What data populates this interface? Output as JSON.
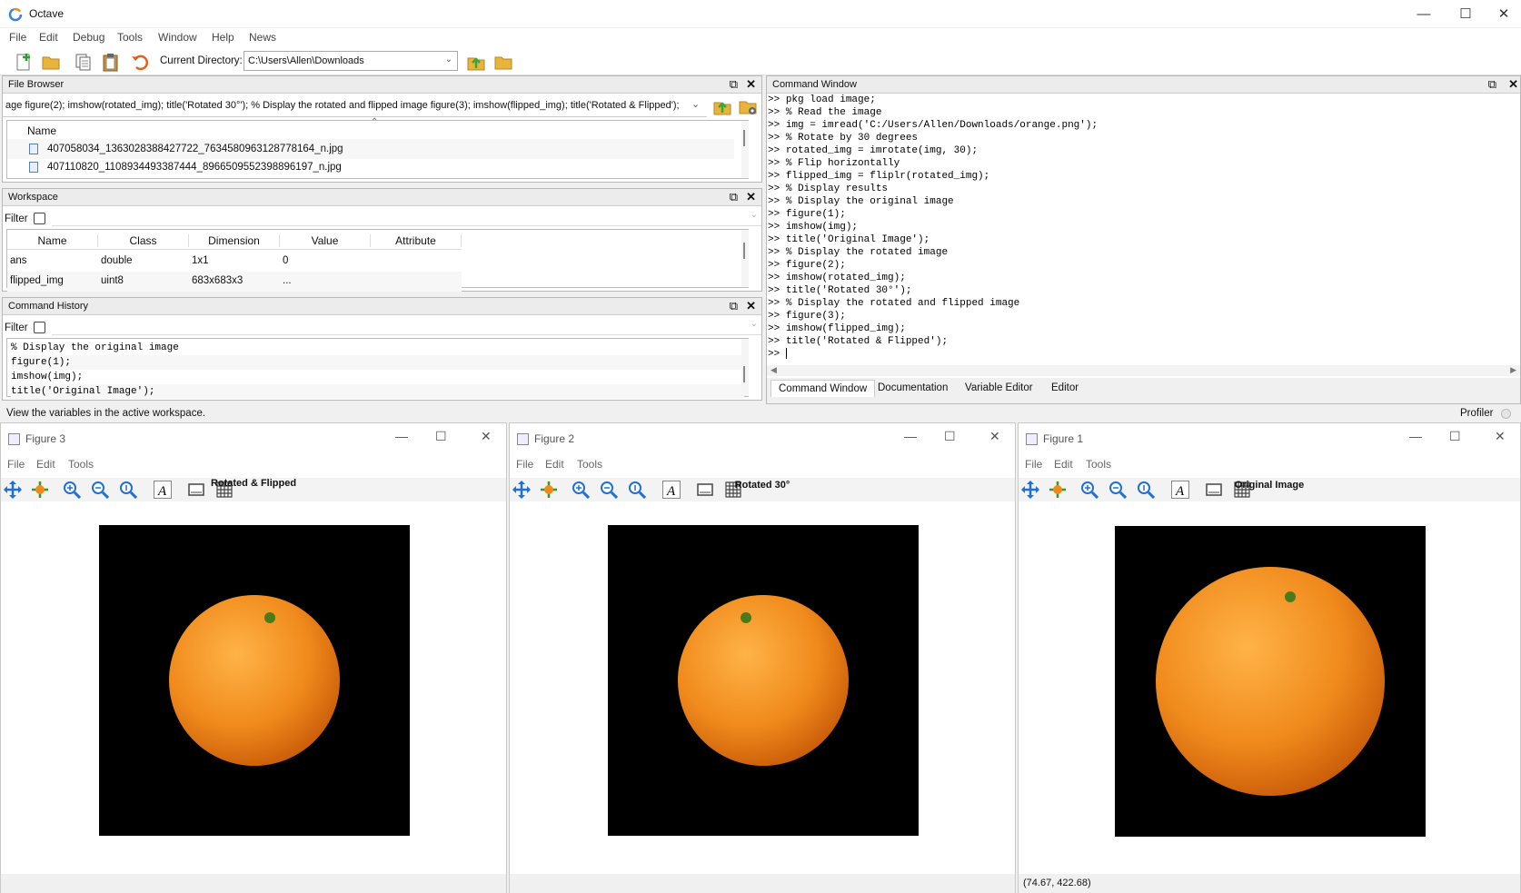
{
  "app": {
    "title": "Octave"
  },
  "menu": [
    "File",
    "Edit",
    "Debug",
    "Tools",
    "Window",
    "Help",
    "News"
  ],
  "toolbar": {
    "current_dir_label": "Current Directory:",
    "current_dir_value": "C:\\Users\\Allen\\Downloads"
  },
  "file_browser": {
    "title": "File Browser",
    "path_value": "age figure(2); imshow(rotated_img); title('Rotated 30°');  % Display the rotated and flipped image figure(3); imshow(flipped_img); title('Rotated & Flipped');",
    "column": "Name",
    "files": [
      "407058034_1363028388427722_7634580963128778164_n.jpg",
      "407110820_1108934493387444_8966509552398896197_n.jpg"
    ]
  },
  "workspace": {
    "title": "Workspace",
    "filter_label": "Filter",
    "columns": [
      "Name",
      "Class",
      "Dimension",
      "Value",
      "Attribute"
    ],
    "rows": [
      {
        "name": "ans",
        "class": "double",
        "dimension": "1x1",
        "value": "0",
        "attribute": ""
      },
      {
        "name": "flipped_img",
        "class": "uint8",
        "dimension": "683x683x3",
        "value": "...",
        "attribute": ""
      }
    ]
  },
  "history": {
    "title": "Command History",
    "filter_label": "Filter",
    "lines": [
      "% Display the original image",
      "figure(1);",
      "imshow(img);",
      "title('Original Image');"
    ]
  },
  "command_window": {
    "title": "Command Window",
    "prompt": ">>",
    "lines": [
      "pkg load image;",
      "% Read the image",
      "img = imread('C:/Users/Allen/Downloads/orange.png');",
      "% Rotate by 30 degrees",
      "rotated_img = imrotate(img, 30);",
      "% Flip horizontally",
      "flipped_img = fliplr(rotated_img);",
      "% Display results",
      "% Display the original image",
      "figure(1);",
      "imshow(img);",
      "title('Original Image');",
      "% Display the rotated image",
      "figure(2);",
      "imshow(rotated_img);",
      "title('Rotated 30°');",
      "% Display the rotated and flipped image",
      "figure(3);",
      "imshow(flipped_img);",
      "title('Rotated & Flipped');",
      ""
    ],
    "tabs": [
      "Command Window",
      "Documentation",
      "Variable Editor",
      "Editor"
    ]
  },
  "status": {
    "text": "View the variables in the active workspace.",
    "profiler": "Profiler"
  },
  "figures": [
    {
      "window_title": "Figure 3",
      "plot_title": "Rotated & Flipped",
      "menu": [
        "File",
        "Edit",
        "Tools"
      ],
      "status": ""
    },
    {
      "window_title": "Figure 2",
      "plot_title": "Rotated 30°",
      "menu": [
        "File",
        "Edit",
        "Tools"
      ],
      "status": ""
    },
    {
      "window_title": "Figure 1",
      "plot_title": "Original Image",
      "menu": [
        "File",
        "Edit",
        "Tools"
      ],
      "status": "(74.67, 422.68)"
    }
  ],
  "colors": {
    "accent_orange": "#f08a1c",
    "icon_blue": "#1e6fd9",
    "folder_yellow": "#e9b43a",
    "green_arrow": "#3aa53a"
  }
}
